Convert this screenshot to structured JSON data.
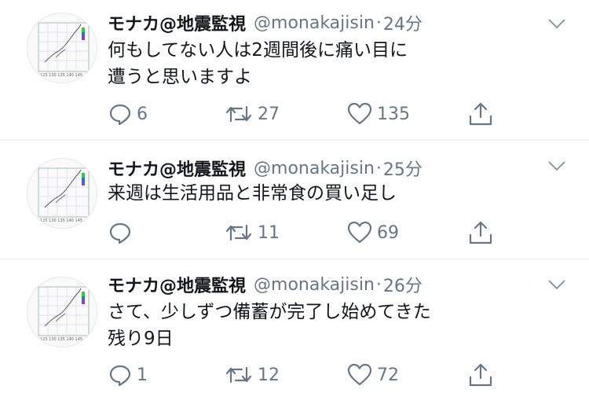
{
  "tweets": [
    {
      "name": "モナカ@地震監視",
      "handle": "@monakajisin",
      "dot": "·",
      "time": "24分",
      "text_lines": [
        "何もしてない人は2週間後に痛い目に",
        "遭うと思いますよ"
      ],
      "replies": "6",
      "retweets": "27",
      "likes": "135"
    },
    {
      "name": "モナカ@地震監視",
      "handle": "@monakajisin",
      "dot": "·",
      "time": "25分",
      "text_lines": [
        "来週は生活用品と非常食の買い足し"
      ],
      "replies": "",
      "retweets": "11",
      "likes": "69"
    },
    {
      "name": "モナカ@地震監視",
      "handle": "@monakajisin",
      "dot": "·",
      "time": "26分",
      "text_lines": [
        "さて、少しずつ備蓄が完了し始めてきた",
        "残り9日"
      ],
      "replies": "1",
      "retweets": "12",
      "likes": "72"
    }
  ],
  "icons": {
    "reply": "reply-icon",
    "retweet": "retweet-icon",
    "like": "heart-icon",
    "share": "share-icon",
    "caret": "chevron-down-icon",
    "avatar": "earthquake-map-avatar"
  },
  "colors": {
    "text": "#14171a",
    "secondary": "#657786",
    "divider": "#e6ecf0"
  }
}
